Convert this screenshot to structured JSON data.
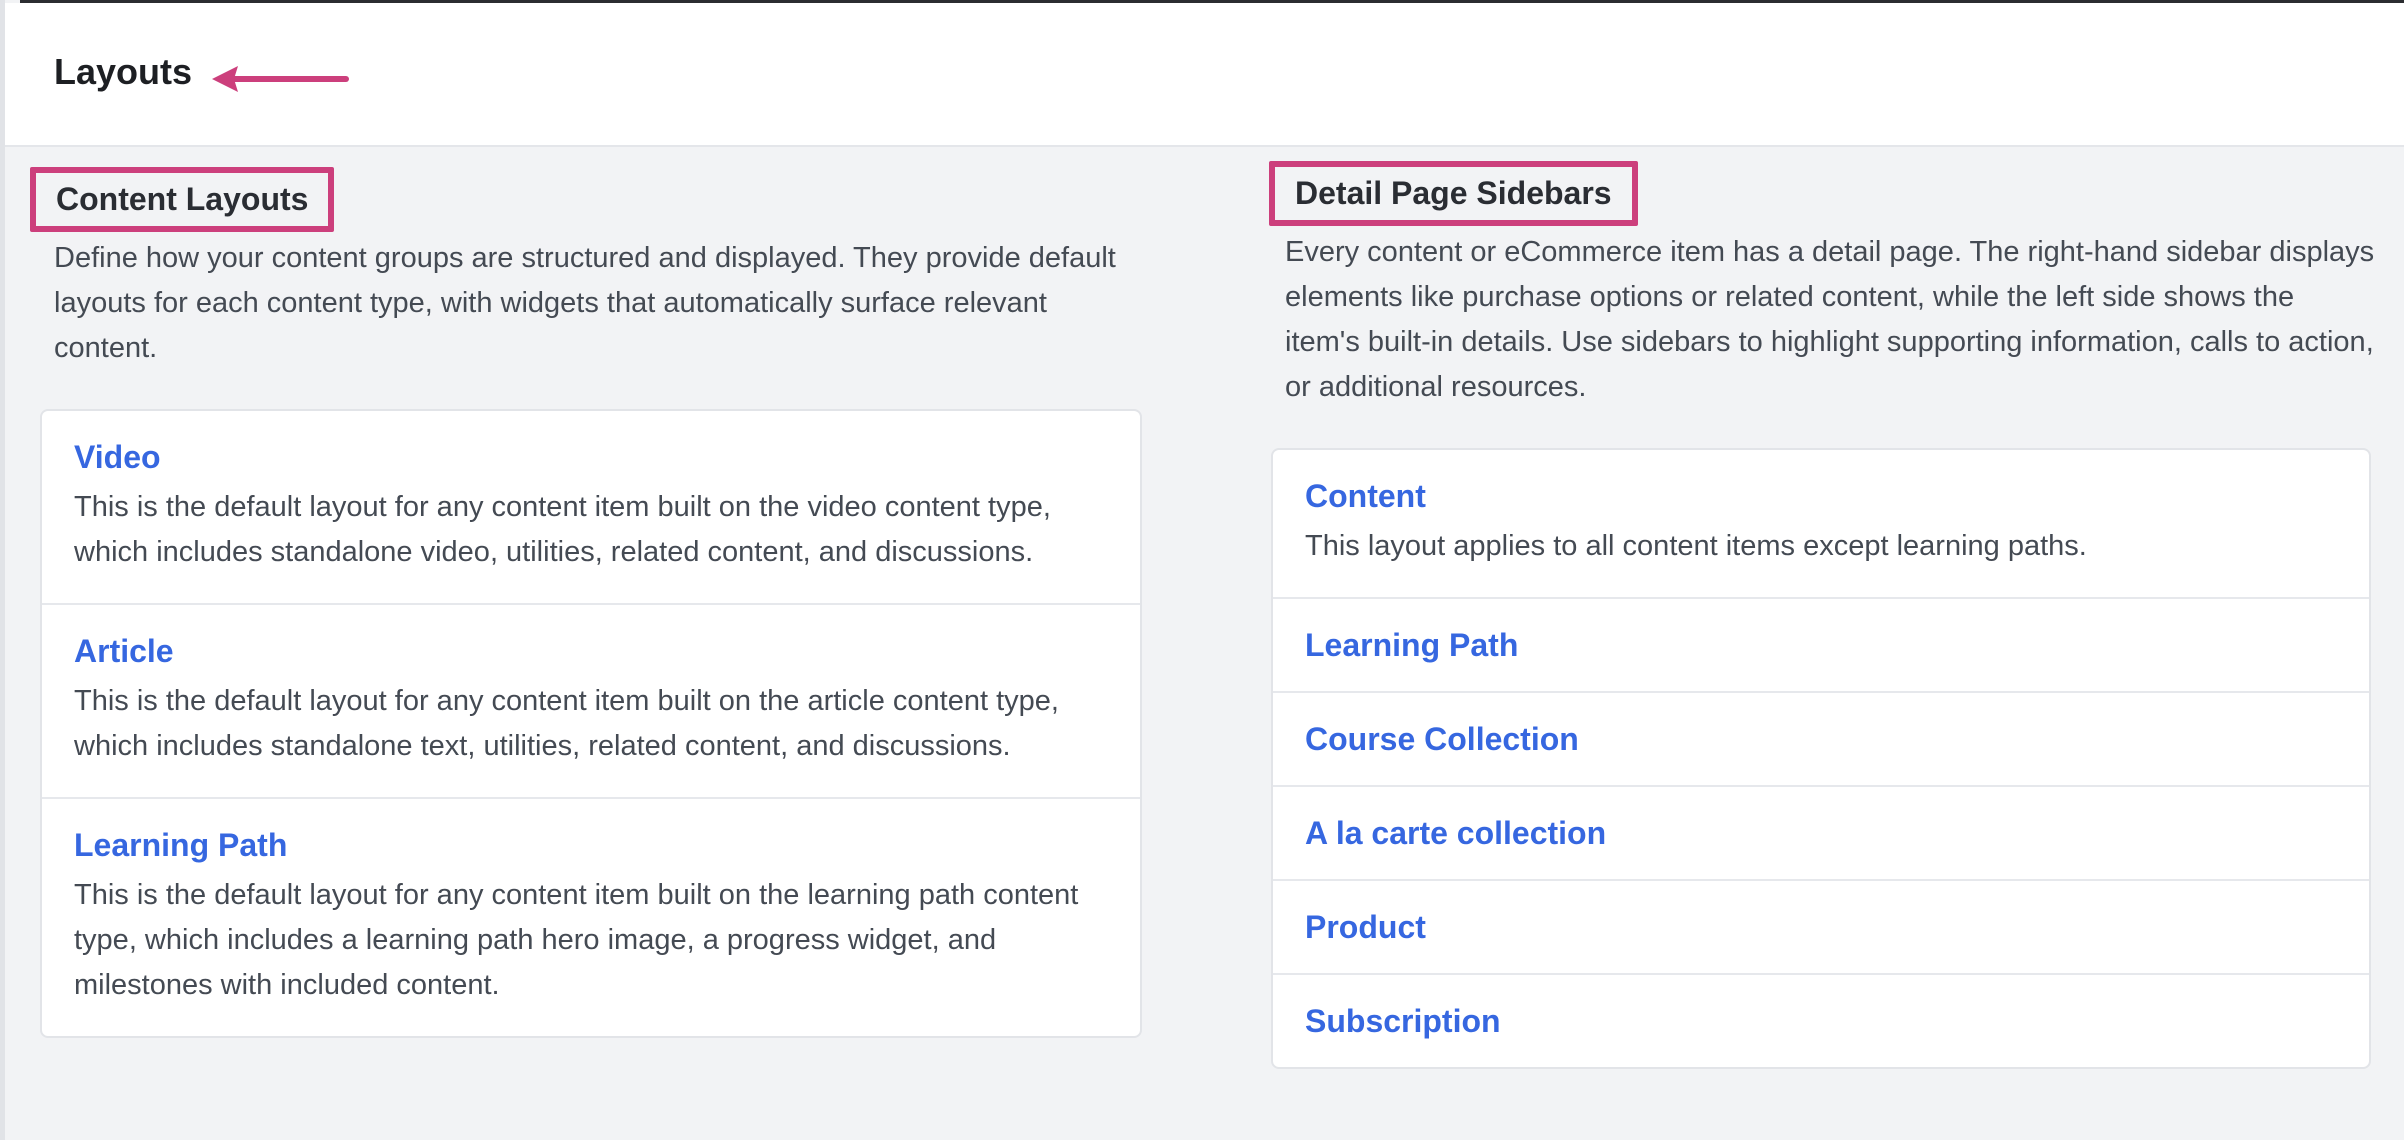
{
  "header": {
    "title": "Layouts"
  },
  "content_layouts": {
    "heading": "Content Layouts",
    "description": "Define how your content groups are structured and displayed. They provide default layouts for each content type, with widgets that automatically surface relevant content.",
    "items": [
      {
        "title": "Video",
        "description": "This is the default layout for any content item built on the video content type, which includes standalone video, utilities, related content, and discussions."
      },
      {
        "title": "Article",
        "description": "This is the default layout for any content item built on the article content type, which includes standalone text, utilities, related content, and discussions."
      },
      {
        "title": "Learning Path",
        "description": "This is the default layout for any content item built on the learning path content type, which includes a learning path hero image, a progress widget, and milestones with included content."
      }
    ]
  },
  "detail_sidebars": {
    "heading": "Detail Page Sidebars",
    "description": "Every content or eCommerce item has a detail page. The right-hand sidebar displays elements like purchase options or related content, while the left side shows the item's built-in details. Use sidebars to highlight supporting information, calls to action, or additional resources.",
    "items": [
      {
        "title": "Content",
        "description": "This layout applies to all content items except learning paths."
      },
      {
        "title": "Learning Path"
      },
      {
        "title": "Course Collection"
      },
      {
        "title": "A la carte collection"
      },
      {
        "title": "Product"
      },
      {
        "title": "Subscription"
      }
    ]
  },
  "colors": {
    "annotation": "#cc3f7c",
    "link": "#3667e0",
    "background": "#f2f3f5"
  }
}
